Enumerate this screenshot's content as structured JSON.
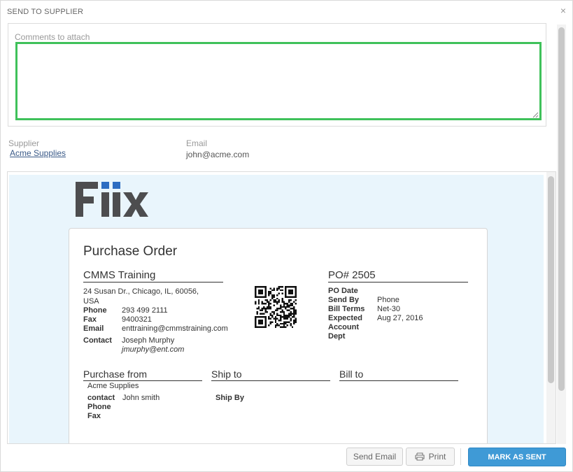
{
  "dialog": {
    "title": "SEND TO SUPPLIER",
    "close_glyph": "×"
  },
  "comments": {
    "label": "Comments to attach",
    "value": ""
  },
  "supplier": {
    "label": "Supplier",
    "name": "Acme Supplies"
  },
  "email": {
    "label": "Email",
    "value": "john@acme.com"
  },
  "po": {
    "title": "Purchase Order",
    "company": {
      "name": "CMMS Training",
      "address_line1": "24 Susan Dr., Chicago, IL, 60056,",
      "address_line2": "USA",
      "phone_label": "Phone",
      "phone": "293 499 2111",
      "fax_label": "Fax",
      "fax": "9400321",
      "email_label": "Email",
      "email": "enttraining@cmmstraining.com",
      "contact_label": "Contact",
      "contact_name": "Joseph Murphy",
      "contact_email": "jmurphy@ent.com"
    },
    "number_header": "PO# 2505",
    "details": {
      "po_date_label": "PO Date",
      "po_date": "",
      "send_by_label": "Send By",
      "send_by": "Phone",
      "bill_terms_label": "Bill Terms",
      "bill_terms": "Net-30",
      "expected_label": "Expected",
      "expected": "Aug 27, 2016",
      "account_label": "Account",
      "dept_label": "Dept"
    },
    "purchase_from": {
      "header": "Purchase from",
      "name": "Acme Supplies",
      "contact_label": "contact",
      "contact": "John smith",
      "phone_label": "Phone",
      "fax_label": "Fax"
    },
    "ship_to": {
      "header": "Ship to",
      "ship_by_label": "Ship By"
    },
    "bill_to": {
      "header": "Bill to"
    }
  },
  "buttons": {
    "send_email": "Send Email",
    "print": "Print",
    "mark_as_sent": "MARK AS SENT"
  },
  "icons": {
    "print": "printer-icon",
    "close": "close-icon",
    "logo": "fiix-logo"
  },
  "colors": {
    "focus_border": "#3fc15a",
    "primary_button": "#3f9ad6",
    "preview_bg": "#e9f5fc",
    "logo_dark": "#4d4d4f",
    "logo_blue": "#2d6dc2"
  }
}
